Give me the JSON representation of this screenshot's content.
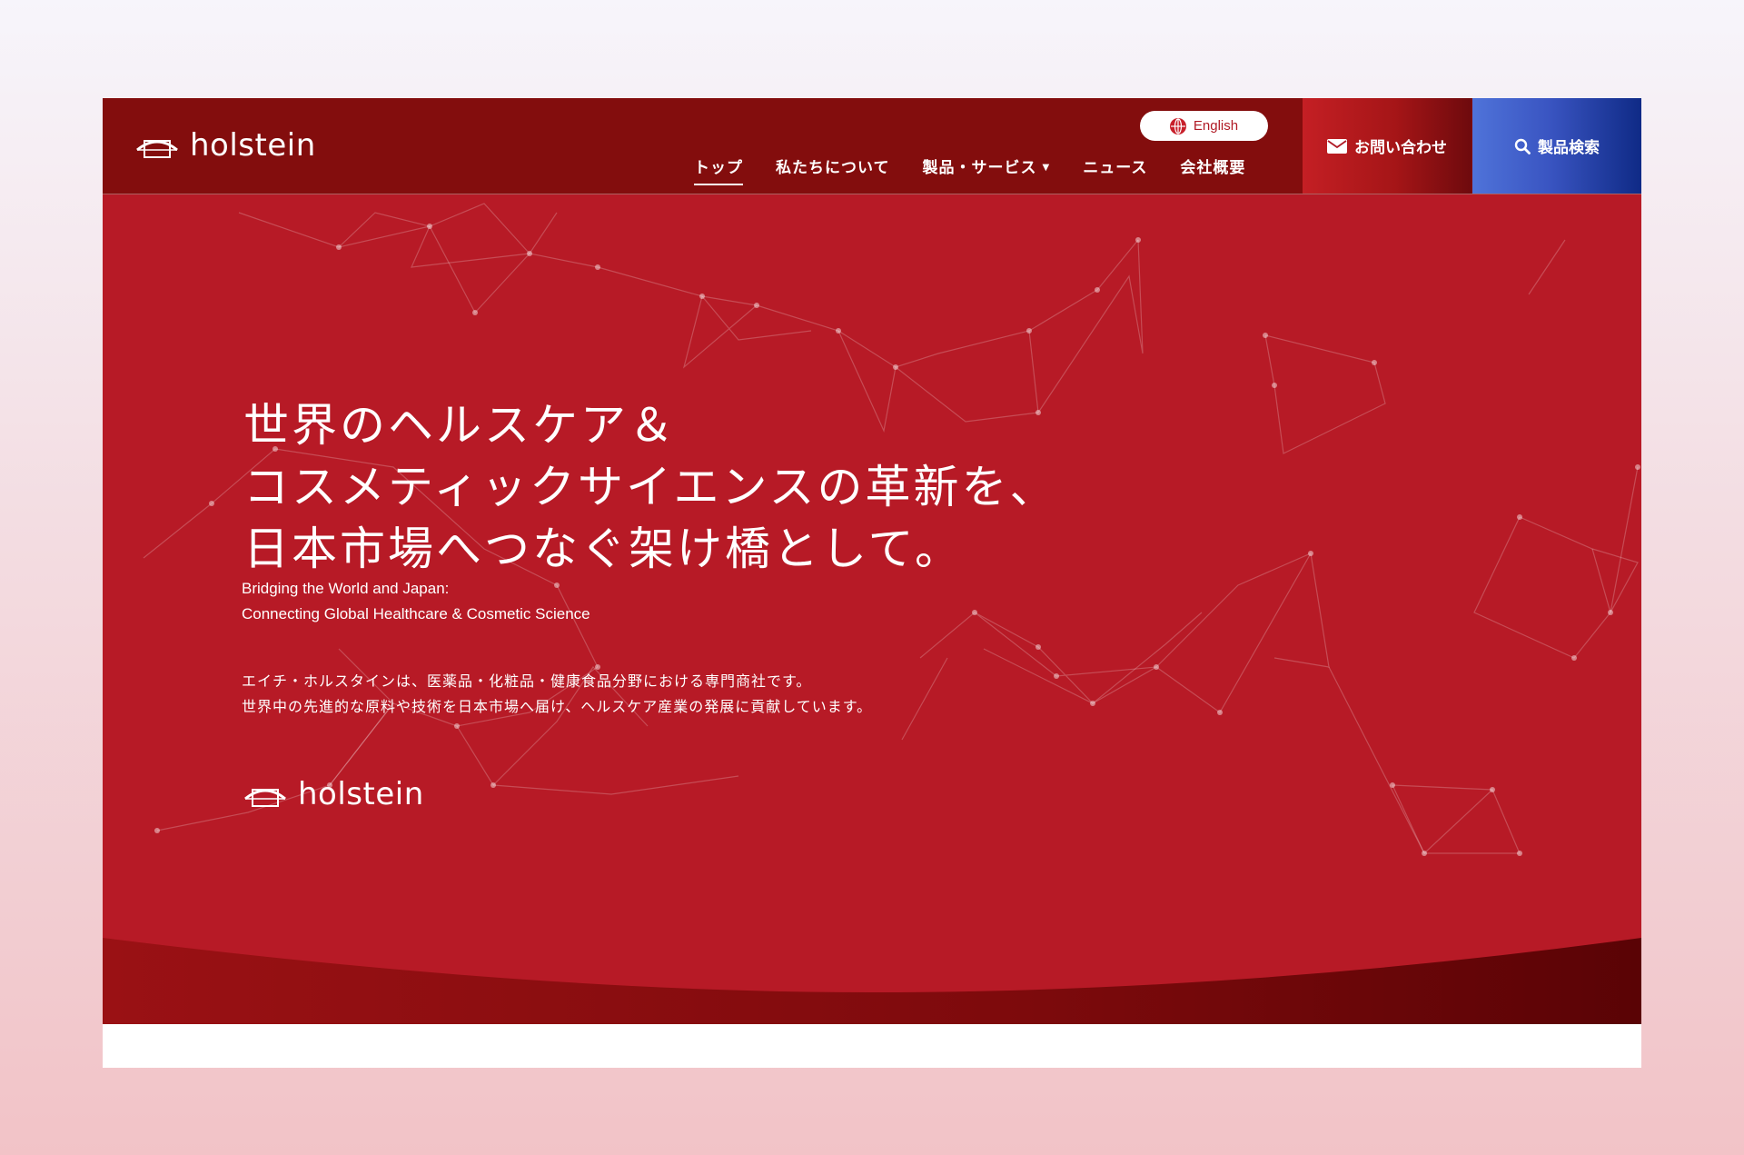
{
  "header": {
    "logo_text": "holstein",
    "language_toggle": "English",
    "nav": [
      {
        "label": "トップ",
        "active": true
      },
      {
        "label": "私たちについて"
      },
      {
        "label": "製品・サービス",
        "has_dropdown": true
      },
      {
        "label": "ニュース"
      },
      {
        "label": "会社概要"
      }
    ],
    "contact_label": "お問い合わせ",
    "search_label": "製品検索"
  },
  "hero": {
    "title_lines": [
      "世界のヘルスケア＆",
      "コスメティックサイエンスの革新を、",
      "日本市場へつなぐ架け橋として。"
    ],
    "subtitle_lines": [
      "Bridging the World and Japan:",
      "Connecting Global Healthcare & Cosmetic Science"
    ],
    "description_lines": [
      "エイチ・ホルスタインは、医薬品・化粧品・健康食品分野における専門商社です。",
      "世界中の先進的な原料や技術を日本市場へ届け、ヘルスケア産業の発展に貢献しています。"
    ],
    "logo_text": "holstein"
  },
  "colors": {
    "header_bg": "#830d0d",
    "hero_bg": "#b71a26",
    "contact_start": "#c41f24",
    "contact_end": "#6e0a0d",
    "search_start": "#4f73d9",
    "search_end": "#0f2a86",
    "page_bg_top": "#f7f5fb",
    "page_bg_bottom": "#f2c3c7"
  },
  "icons": {
    "logo": "holstein-arc-logo-icon",
    "language": "globe-icon",
    "contact": "envelope-icon",
    "search": "search-icon",
    "dropdown": "caret-down-icon"
  }
}
